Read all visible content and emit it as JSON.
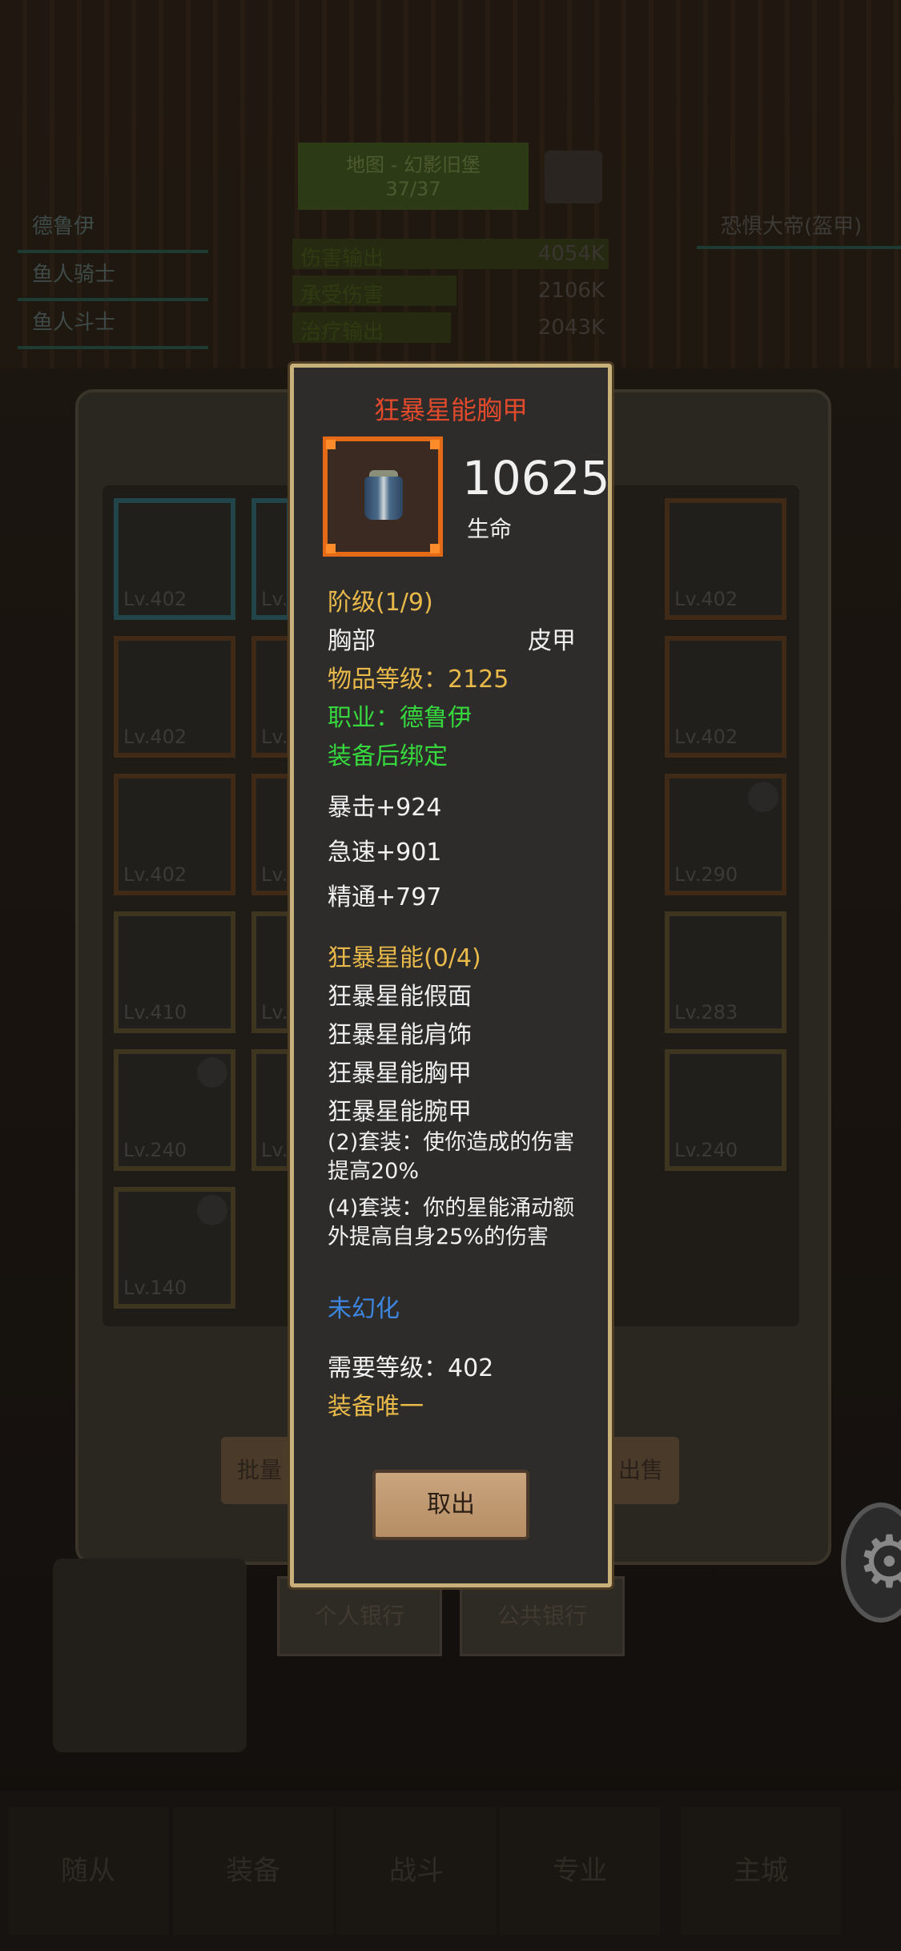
{
  "background": {
    "title_line1": "地图 - 幻影旧堡",
    "title_line2": "37/37",
    "left_list": [
      "德鲁伊",
      "鱼人骑士",
      "鱼人斗士"
    ],
    "right_name": "恐惧大帝(盔甲)",
    "stats": [
      {
        "label": "伤害输出",
        "value": "4054K",
        "fill": 1.0
      },
      {
        "label": "承受伤害",
        "value": "2106K",
        "fill": 0.52
      },
      {
        "label": "治疗输出",
        "value": "2043K",
        "fill": 0.5
      }
    ],
    "slots": [
      {
        "lv": "Lv.402",
        "color": "blue",
        "lock": false
      },
      {
        "lv": "Lv.",
        "color": "blue",
        "lock": false
      },
      {
        "lv": "Lv.402",
        "color": "orange",
        "lock": false
      },
      {
        "lv": "Lv.402",
        "color": "orange",
        "lock": false
      },
      {
        "lv": "Lv.",
        "color": "orange",
        "lock": false
      },
      {
        "lv": "Lv.402",
        "color": "orange",
        "lock": false
      },
      {
        "lv": "Lv.402",
        "color": "orange",
        "lock": false
      },
      {
        "lv": "Lv.",
        "color": "orange",
        "lock": false
      },
      {
        "lv": "Lv.290",
        "color": "orange",
        "lock": true
      },
      {
        "lv": "Lv.410",
        "color": "gold",
        "lock": false
      },
      {
        "lv": "Lv.",
        "color": "gold",
        "lock": false
      },
      {
        "lv": "Lv.283",
        "color": "gold",
        "lock": false
      },
      {
        "lv": "Lv.240",
        "color": "gold",
        "lock": true
      },
      {
        "lv": "Lv.",
        "color": "gold",
        "lock": false
      },
      {
        "lv": "Lv.240",
        "color": "gold",
        "lock": false
      },
      {
        "lv": "Lv.140",
        "color": "gold",
        "lock": true
      }
    ],
    "buttons": {
      "batch": "批量",
      "sell": "出售"
    },
    "tabs": {
      "personal_bank": "个人银行",
      "public_bank": "公共银行"
    },
    "nav": [
      "随从",
      "装备",
      "战斗",
      "专业",
      "主城"
    ]
  },
  "tooltip": {
    "title": "狂暴星能胸甲",
    "main_stat_value": "10625",
    "main_stat_label": "生命",
    "tier": "阶级(1/9)",
    "slot": "胸部",
    "armor_type": "皮甲",
    "item_level": "物品等级：2125",
    "class_req": "职业：德鲁伊",
    "bind": "装备后绑定",
    "stats": [
      "暴击+924",
      "急速+901",
      "精通+797"
    ],
    "set_name": "狂暴星能(0/4)",
    "set_items": [
      "狂暴星能假面",
      "狂暴星能肩饰",
      "狂暴星能胸甲",
      "狂暴星能腕甲"
    ],
    "set_bonus_2": "(2)套装：使你造成的伤害提高20%",
    "set_bonus_4": "(4)套装：你的星能涌动额外提高自身25%的伤害",
    "transmog": "未幻化",
    "required_level": "需要等级：402",
    "unique": "装备唯一",
    "take_out_label": "取出"
  },
  "colors": {
    "title_red": "#e24a2c",
    "yellow": "#e9b94a",
    "green": "#36d83e",
    "blue": "#3d86e0",
    "frame_orange": "#e46a18"
  }
}
